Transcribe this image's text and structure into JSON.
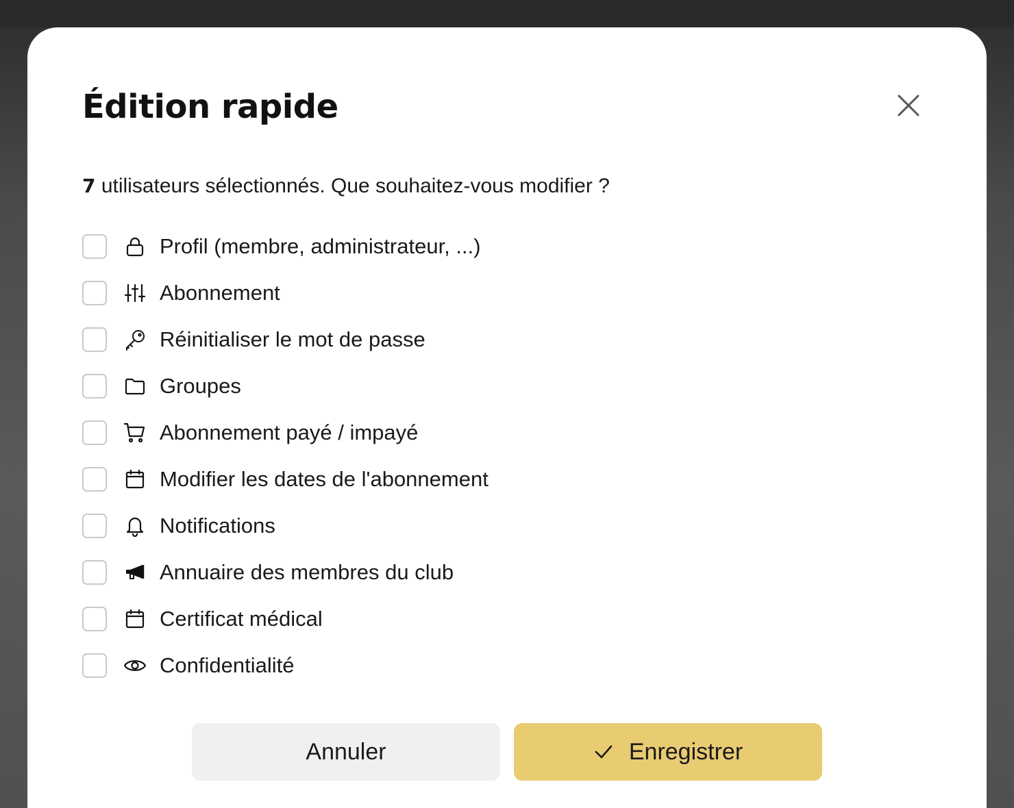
{
  "modal": {
    "title": "Édition rapide",
    "intro_count": "7",
    "intro_text": "utilisateurs sélectionnés. Que souhaitez-vous modifier ?",
    "options": [
      {
        "label": "Profil (membre, administrateur, ...)",
        "icon": "lock-icon",
        "checked": false
      },
      {
        "label": "Abonnement",
        "icon": "sliders-icon",
        "checked": false
      },
      {
        "label": "Réinitialiser le mot de passe",
        "icon": "key-icon",
        "checked": false
      },
      {
        "label": "Groupes",
        "icon": "folder-icon",
        "checked": false
      },
      {
        "label": "Abonnement payé / impayé",
        "icon": "cart-icon",
        "checked": false
      },
      {
        "label": "Modifier les dates de l'abonnement",
        "icon": "calendar-icon",
        "checked": false
      },
      {
        "label": "Notifications",
        "icon": "bell-icon",
        "checked": false
      },
      {
        "label": "Annuaire des membres du club",
        "icon": "megaphone-icon",
        "checked": false
      },
      {
        "label": "Certificat médical",
        "icon": "calendar-icon",
        "checked": false
      },
      {
        "label": "Confidentialité",
        "icon": "eye-icon",
        "checked": false
      }
    ],
    "cancel_label": "Annuler",
    "save_label": "Enregistrer",
    "close_icon": "close-icon",
    "save_icon": "check-icon"
  },
  "colors": {
    "save_button": "#e9cb72",
    "cancel_button": "#f0f0f0",
    "checkbox_border": "#c9c9c9",
    "text": "#1a1a1a"
  }
}
